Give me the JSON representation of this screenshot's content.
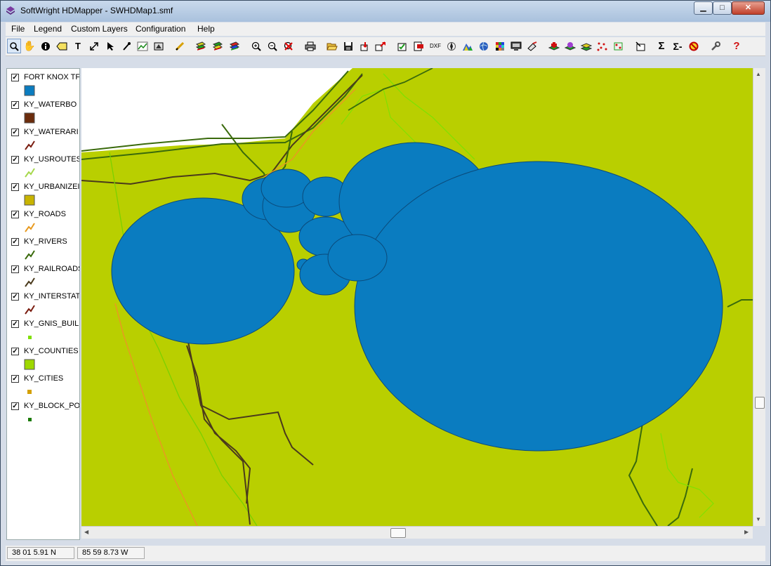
{
  "window": {
    "title": "SoftWright HDMapper - SWHDMap1.smf"
  },
  "menu": {
    "items": [
      "File",
      "Legend",
      "Custom Layers",
      "Configuration",
      "Help"
    ]
  },
  "toolbar": {
    "text_tool": "T",
    "dxf_label": "DXF",
    "sum_label": "Σ",
    "sum2_label": "Σ-",
    "help_label": "?"
  },
  "legend": {
    "layers": [
      {
        "label": "FORT KNOX TF",
        "checked": true,
        "symbol": "square",
        "color": "#0a7cc0"
      },
      {
        "label": "KY_WATERBO",
        "checked": true,
        "symbol": "square",
        "color": "#6b2c0c"
      },
      {
        "label": "KY_WATERARI",
        "checked": true,
        "symbol": "line",
        "color": "#7a1d10"
      },
      {
        "label": "KY_USROUTES",
        "checked": true,
        "symbol": "line",
        "color": "#a6d84c"
      },
      {
        "label": "KY_URBANIZEI",
        "checked": true,
        "symbol": "square",
        "color": "#c8b400"
      },
      {
        "label": "KY_ROADS",
        "checked": true,
        "symbol": "line",
        "color": "#e89a20"
      },
      {
        "label": "KY_RIVERS",
        "checked": true,
        "symbol": "line",
        "color": "#3a6a0c"
      },
      {
        "label": "KY_RAILROADS",
        "checked": true,
        "symbol": "line",
        "color": "#4a3a1c"
      },
      {
        "label": "KY_INTERSTAT",
        "checked": true,
        "symbol": "line",
        "color": "#7a1d10"
      },
      {
        "label": "KY_GNIS_BUIL",
        "checked": true,
        "symbol": "dot",
        "color": "#80e000"
      },
      {
        "label": "KY_COUNTIES",
        "checked": true,
        "symbol": "square",
        "color": "#9ed800"
      },
      {
        "label": "KY_CITIES",
        "checked": true,
        "symbol": "dot",
        "color": "#d4a000"
      },
      {
        "label": "KY_BLOCK_PO",
        "checked": true,
        "symbol": "dot",
        "color": "#1a7a00"
      }
    ]
  },
  "map": {
    "county_fill": "#b9cf00",
    "coverage_fill": "#0a7cc0",
    "water_fill": "#ffffff"
  },
  "status": {
    "lat": "38 01 5.91 N",
    "lon": "85 59 8.73 W"
  }
}
